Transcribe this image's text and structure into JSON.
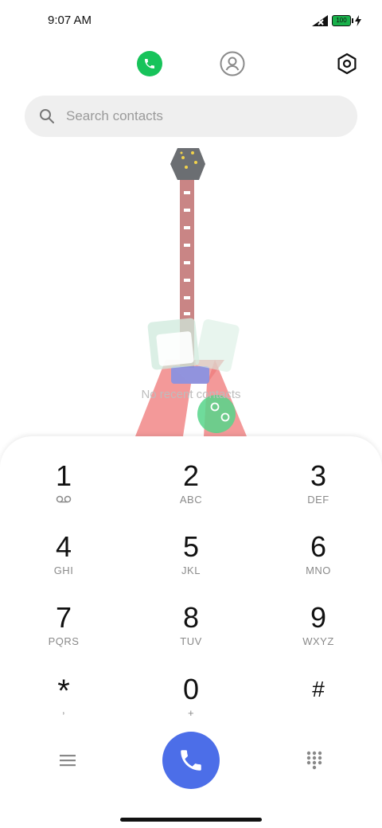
{
  "status_bar": {
    "time": "9:07 AM",
    "battery": "100"
  },
  "search": {
    "placeholder": "Search contacts"
  },
  "empty_state": {
    "text": "No recent contacts"
  },
  "dialpad": {
    "keys": [
      {
        "digit": "1",
        "letters": ""
      },
      {
        "digit": "2",
        "letters": "ABC"
      },
      {
        "digit": "3",
        "letters": "DEF"
      },
      {
        "digit": "4",
        "letters": "GHI"
      },
      {
        "digit": "5",
        "letters": "JKL"
      },
      {
        "digit": "6",
        "letters": "MNO"
      },
      {
        "digit": "7",
        "letters": "PQRS"
      },
      {
        "digit": "8",
        "letters": "TUV"
      },
      {
        "digit": "9",
        "letters": "WXYZ"
      },
      {
        "digit": "*",
        "letters": ","
      },
      {
        "digit": "0",
        "letters": "+"
      },
      {
        "digit": "#",
        "letters": ""
      }
    ]
  },
  "colors": {
    "accent_call": "#4c6ee8",
    "phone_tab": "#17c35a"
  }
}
